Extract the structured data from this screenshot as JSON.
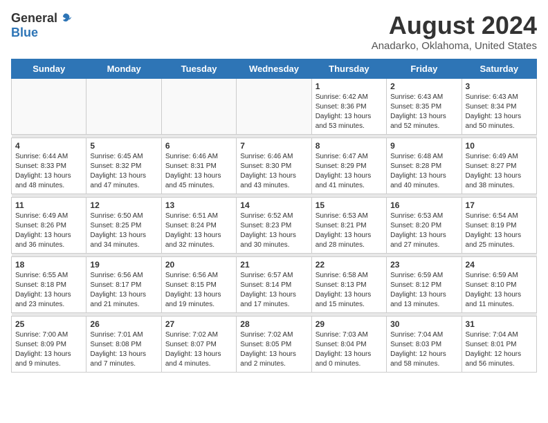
{
  "logo": {
    "general": "General",
    "blue": "Blue"
  },
  "title": "August 2024",
  "location": "Anadarko, Oklahoma, United States",
  "days_header": [
    "Sunday",
    "Monday",
    "Tuesday",
    "Wednesday",
    "Thursday",
    "Friday",
    "Saturday"
  ],
  "weeks": [
    [
      {
        "day": "",
        "info": ""
      },
      {
        "day": "",
        "info": ""
      },
      {
        "day": "",
        "info": ""
      },
      {
        "day": "",
        "info": ""
      },
      {
        "day": "1",
        "info": "Sunrise: 6:42 AM\nSunset: 8:36 PM\nDaylight: 13 hours\nand 53 minutes."
      },
      {
        "day": "2",
        "info": "Sunrise: 6:43 AM\nSunset: 8:35 PM\nDaylight: 13 hours\nand 52 minutes."
      },
      {
        "day": "3",
        "info": "Sunrise: 6:43 AM\nSunset: 8:34 PM\nDaylight: 13 hours\nand 50 minutes."
      }
    ],
    [
      {
        "day": "4",
        "info": "Sunrise: 6:44 AM\nSunset: 8:33 PM\nDaylight: 13 hours\nand 48 minutes."
      },
      {
        "day": "5",
        "info": "Sunrise: 6:45 AM\nSunset: 8:32 PM\nDaylight: 13 hours\nand 47 minutes."
      },
      {
        "day": "6",
        "info": "Sunrise: 6:46 AM\nSunset: 8:31 PM\nDaylight: 13 hours\nand 45 minutes."
      },
      {
        "day": "7",
        "info": "Sunrise: 6:46 AM\nSunset: 8:30 PM\nDaylight: 13 hours\nand 43 minutes."
      },
      {
        "day": "8",
        "info": "Sunrise: 6:47 AM\nSunset: 8:29 PM\nDaylight: 13 hours\nand 41 minutes."
      },
      {
        "day": "9",
        "info": "Sunrise: 6:48 AM\nSunset: 8:28 PM\nDaylight: 13 hours\nand 40 minutes."
      },
      {
        "day": "10",
        "info": "Sunrise: 6:49 AM\nSunset: 8:27 PM\nDaylight: 13 hours\nand 38 minutes."
      }
    ],
    [
      {
        "day": "11",
        "info": "Sunrise: 6:49 AM\nSunset: 8:26 PM\nDaylight: 13 hours\nand 36 minutes."
      },
      {
        "day": "12",
        "info": "Sunrise: 6:50 AM\nSunset: 8:25 PM\nDaylight: 13 hours\nand 34 minutes."
      },
      {
        "day": "13",
        "info": "Sunrise: 6:51 AM\nSunset: 8:24 PM\nDaylight: 13 hours\nand 32 minutes."
      },
      {
        "day": "14",
        "info": "Sunrise: 6:52 AM\nSunset: 8:23 PM\nDaylight: 13 hours\nand 30 minutes."
      },
      {
        "day": "15",
        "info": "Sunrise: 6:53 AM\nSunset: 8:21 PM\nDaylight: 13 hours\nand 28 minutes."
      },
      {
        "day": "16",
        "info": "Sunrise: 6:53 AM\nSunset: 8:20 PM\nDaylight: 13 hours\nand 27 minutes."
      },
      {
        "day": "17",
        "info": "Sunrise: 6:54 AM\nSunset: 8:19 PM\nDaylight: 13 hours\nand 25 minutes."
      }
    ],
    [
      {
        "day": "18",
        "info": "Sunrise: 6:55 AM\nSunset: 8:18 PM\nDaylight: 13 hours\nand 23 minutes."
      },
      {
        "day": "19",
        "info": "Sunrise: 6:56 AM\nSunset: 8:17 PM\nDaylight: 13 hours\nand 21 minutes."
      },
      {
        "day": "20",
        "info": "Sunrise: 6:56 AM\nSunset: 8:15 PM\nDaylight: 13 hours\nand 19 minutes."
      },
      {
        "day": "21",
        "info": "Sunrise: 6:57 AM\nSunset: 8:14 PM\nDaylight: 13 hours\nand 17 minutes."
      },
      {
        "day": "22",
        "info": "Sunrise: 6:58 AM\nSunset: 8:13 PM\nDaylight: 13 hours\nand 15 minutes."
      },
      {
        "day": "23",
        "info": "Sunrise: 6:59 AM\nSunset: 8:12 PM\nDaylight: 13 hours\nand 13 minutes."
      },
      {
        "day": "24",
        "info": "Sunrise: 6:59 AM\nSunset: 8:10 PM\nDaylight: 13 hours\nand 11 minutes."
      }
    ],
    [
      {
        "day": "25",
        "info": "Sunrise: 7:00 AM\nSunset: 8:09 PM\nDaylight: 13 hours\nand 9 minutes."
      },
      {
        "day": "26",
        "info": "Sunrise: 7:01 AM\nSunset: 8:08 PM\nDaylight: 13 hours\nand 7 minutes."
      },
      {
        "day": "27",
        "info": "Sunrise: 7:02 AM\nSunset: 8:07 PM\nDaylight: 13 hours\nand 4 minutes."
      },
      {
        "day": "28",
        "info": "Sunrise: 7:02 AM\nSunset: 8:05 PM\nDaylight: 13 hours\nand 2 minutes."
      },
      {
        "day": "29",
        "info": "Sunrise: 7:03 AM\nSunset: 8:04 PM\nDaylight: 13 hours\nand 0 minutes."
      },
      {
        "day": "30",
        "info": "Sunrise: 7:04 AM\nSunset: 8:03 PM\nDaylight: 12 hours\nand 58 minutes."
      },
      {
        "day": "31",
        "info": "Sunrise: 7:04 AM\nSunset: 8:01 PM\nDaylight: 12 hours\nand 56 minutes."
      }
    ]
  ]
}
